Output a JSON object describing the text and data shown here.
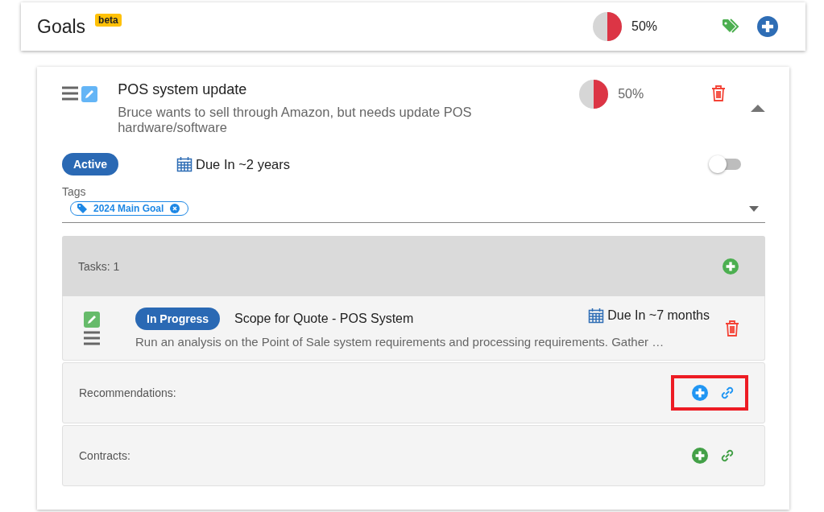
{
  "header": {
    "title": "Goals",
    "badge": "beta",
    "progress": {
      "level": 0.5,
      "reading": "50%"
    }
  },
  "goal": {
    "title": "POS system update",
    "description": "Bruce wants to sell through Amazon, but needs update POS hardware/software",
    "progress": {
      "level": 0.5,
      "reading": "50%"
    },
    "expanded": true,
    "status": "Active",
    "due": "Due In ~2 years",
    "toggle": {
      "on": false
    },
    "tags_label": "Tags",
    "tags": [
      {
        "label": "2024 Main Goal"
      }
    ],
    "tasks": {
      "label": "Tasks: 1",
      "items": [
        {
          "status": "In Progress",
          "title": "Scope for Quote - POS System",
          "due": "Due In ~7 months",
          "description": "Run an analysis on the Point of Sale system requirements and processing requirements. Gather …"
        }
      ]
    },
    "sections": [
      {
        "label": "Recommendations:",
        "color": "#2196f3",
        "highlighted": true
      },
      {
        "label": "Contracts:",
        "color": "#43a047",
        "highlighted": false
      }
    ]
  }
}
